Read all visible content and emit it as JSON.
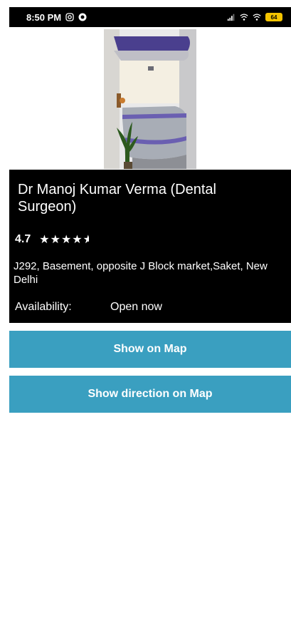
{
  "status_bar": {
    "time": "8:50 PM",
    "battery": "64",
    "icons": [
      "instagram-icon",
      "notification-dot-icon",
      "signal-icon",
      "wifi-icon",
      "battery-icon"
    ]
  },
  "doctor": {
    "name": "Dr Manoj Kumar Verma (Dental Surgeon)",
    "rating_text": "4.7",
    "rating": 4.7,
    "address": "J292, Basement, opposite J Block market,Saket, New Delhi",
    "availability_label": "Availability:",
    "availability_value": "Open now"
  },
  "actions": {
    "show_on_map": "Show on Map",
    "show_direction": "Show direction on Map"
  },
  "colors": {
    "button": "#3a9fc0",
    "panel": "#000000",
    "battery": "#f5c400"
  }
}
